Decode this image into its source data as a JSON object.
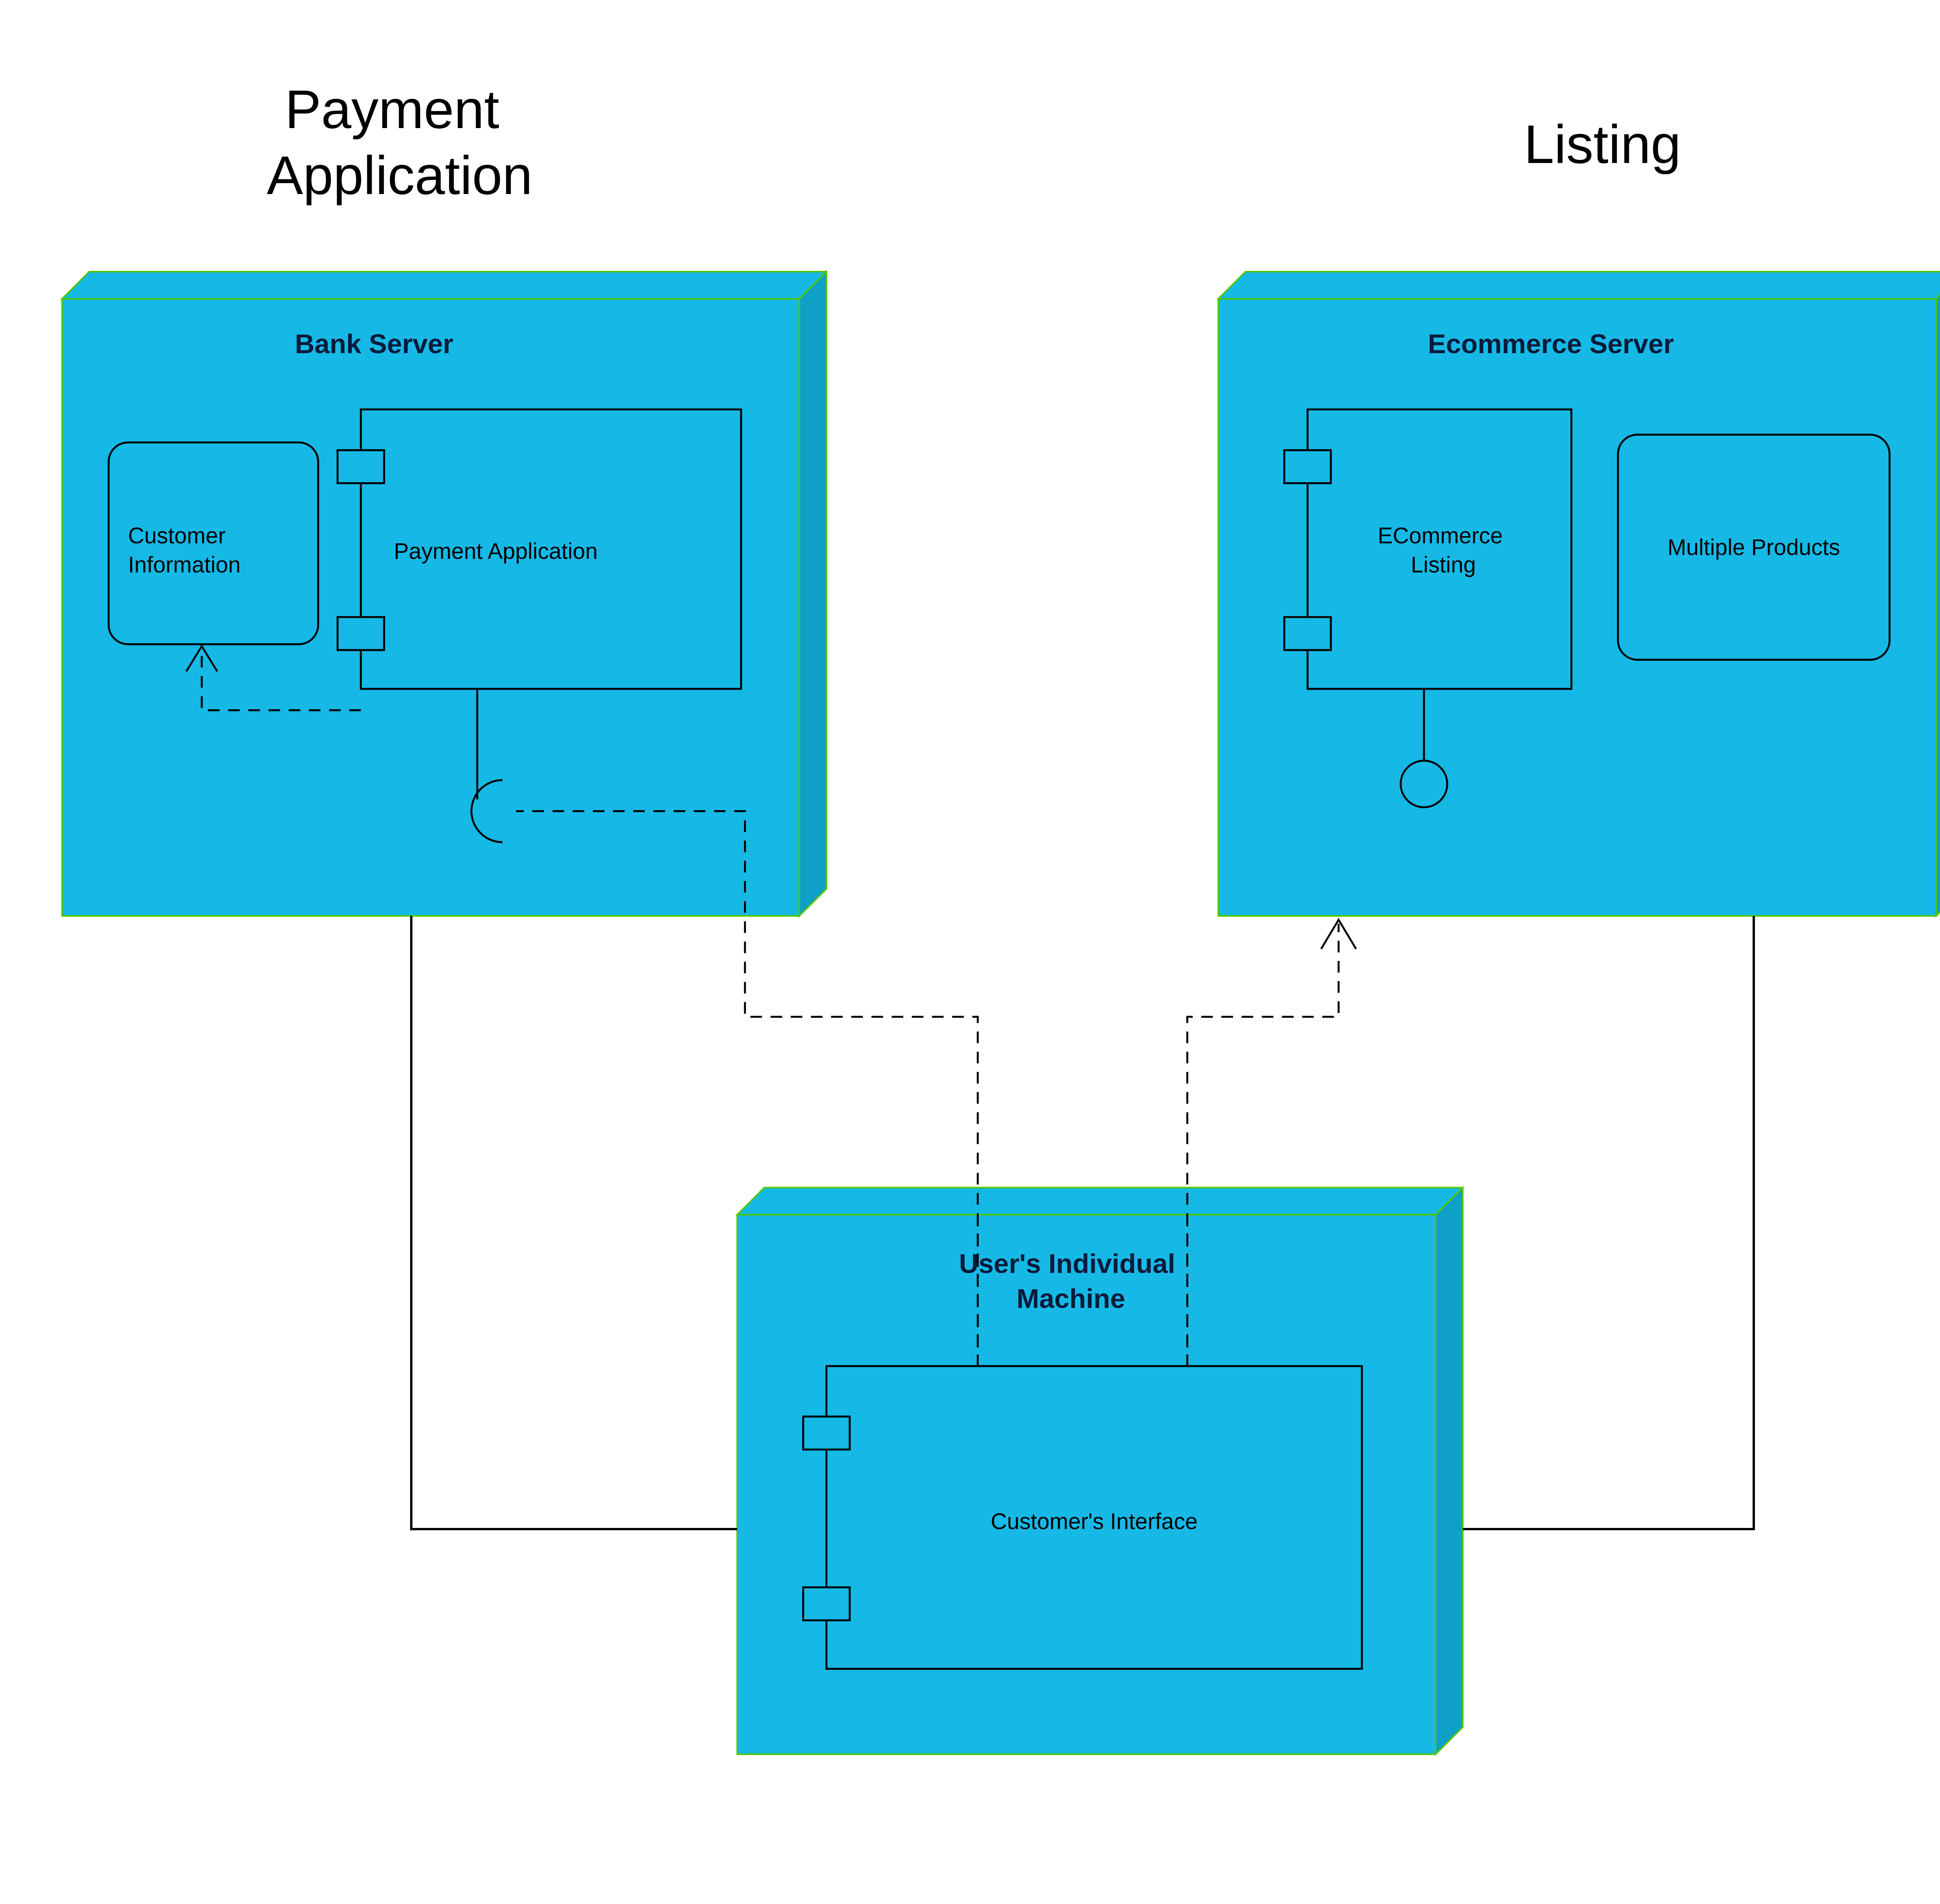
{
  "titles": {
    "payment_app": "Payment",
    "payment_app_line2": "Application",
    "listing": "Listing"
  },
  "nodes": {
    "bank_server": "Bank Server",
    "ecommerce_server": "Ecommerce Server",
    "user_machine": "User's Individual",
    "user_machine_line2": "Machine"
  },
  "components": {
    "customer_info": "Customer",
    "customer_info_line2": "Information",
    "payment_app": "Payment Application",
    "ecommerce_listing": "ECommerce",
    "ecommerce_listing_line2": "Listing",
    "multiple_products": "Multiple Products",
    "customers_interface": "Customer's Interface"
  },
  "colors": {
    "node_fill": "#16b9e6",
    "node_side": "#0fa0c8",
    "node_stroke": "#4fc800",
    "box_stroke": "#000000"
  }
}
